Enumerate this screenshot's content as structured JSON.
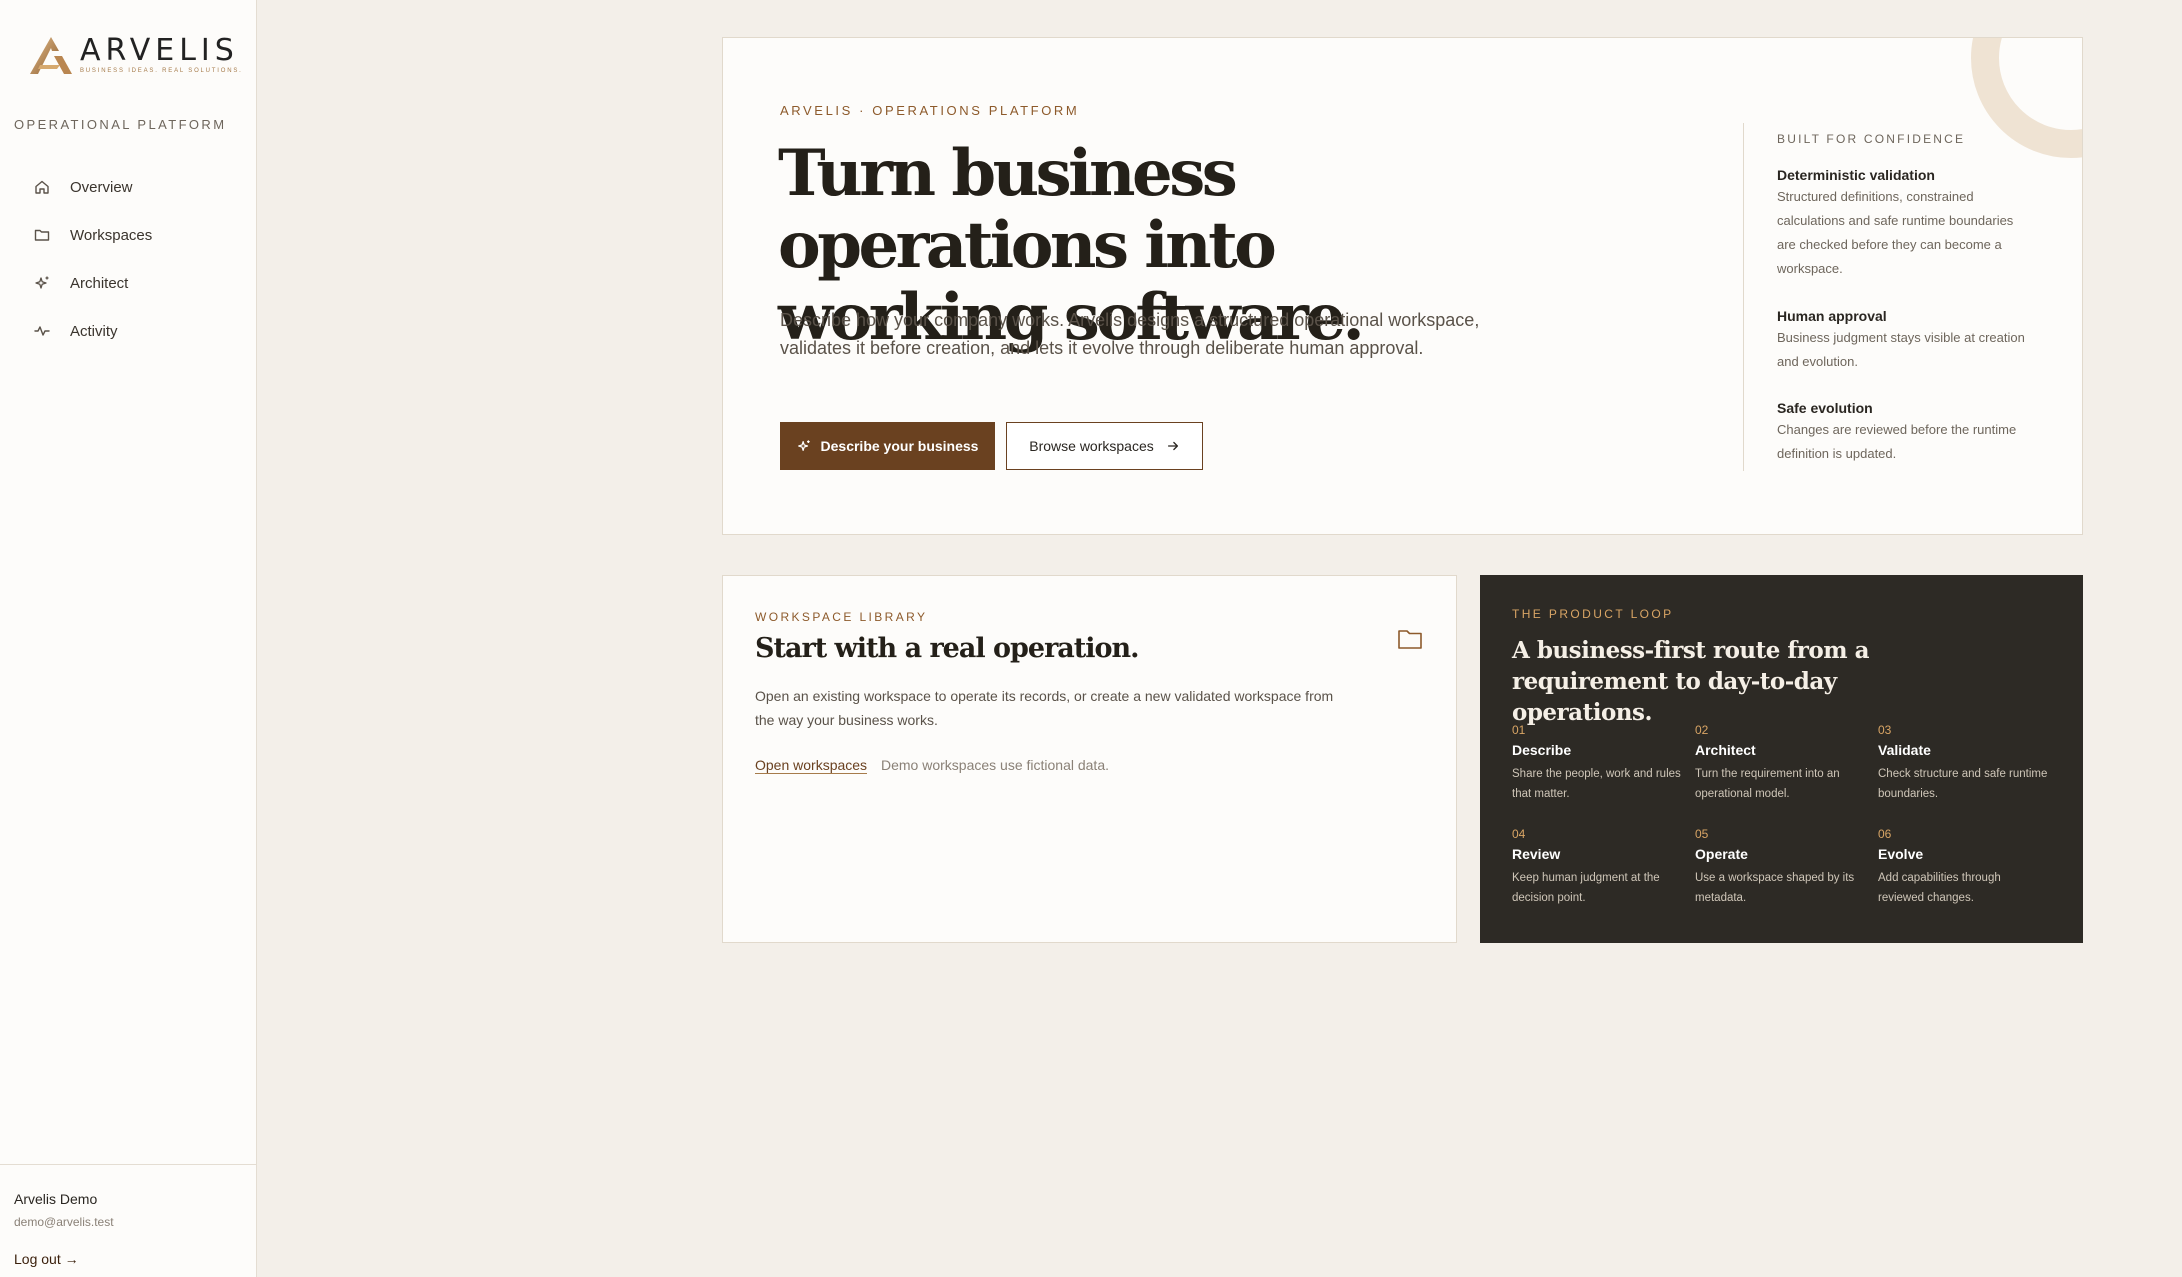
{
  "sidebar": {
    "logo": {
      "word": "ARVELIS",
      "tagline": "BUSINESS IDEAS. REAL SOLUTIONS."
    },
    "platform_label": "OPERATIONAL PLATFORM",
    "items": [
      {
        "label": "Overview",
        "icon": "home-icon"
      },
      {
        "label": "Workspaces",
        "icon": "folder-icon"
      },
      {
        "label": "Architect",
        "icon": "sparkle-icon"
      },
      {
        "label": "Activity",
        "icon": "activity-icon"
      }
    ],
    "user": {
      "name": "Arvelis Demo",
      "email": "demo@arvelis.test"
    },
    "logout_label": "Log out →"
  },
  "hero": {
    "eyebrow": "ARVELIS · OPERATIONS PLATFORM",
    "title": "Turn business operations into working software.",
    "description": "Describe how your company works. Arvelis designs a structured operational workspace, validates it before creation, and lets it evolve through deliberate human approval.",
    "primary_button": "Describe your business",
    "secondary_button": "Browse workspaces"
  },
  "confidence": {
    "eyebrow": "BUILT FOR CONFIDENCE",
    "items": [
      {
        "title": "Deterministic validation",
        "text": "Structured definitions, constrained calculations and safe runtime boundaries are checked before they can become a workspace."
      },
      {
        "title": "Human approval",
        "text": "Business judgment stays visible at creation and evolution."
      },
      {
        "title": "Safe evolution",
        "text": "Changes are reviewed before the runtime definition is updated."
      }
    ]
  },
  "library": {
    "eyebrow": "WORKSPACE LIBRARY",
    "title": "Start with a real operation.",
    "description": "Open an existing workspace to operate its records, or create a new validated workspace from the way your business works.",
    "link": "Open workspaces",
    "note": "Demo workspaces use fictional data."
  },
  "loop": {
    "eyebrow": "THE PRODUCT LOOP",
    "title": "A business-first route from a requirement to day-to-day operations.",
    "steps": [
      {
        "num": "01",
        "title": "Describe",
        "text": "Share the people, work and rules that matter."
      },
      {
        "num": "02",
        "title": "Architect",
        "text": "Turn the requirement into an operational model."
      },
      {
        "num": "03",
        "title": "Validate",
        "text": "Check structure and safe runtime boundaries."
      },
      {
        "num": "04",
        "title": "Review",
        "text": "Keep human judgment at the decision point."
      },
      {
        "num": "05",
        "title": "Operate",
        "text": "Use a workspace shaped by its metadata."
      },
      {
        "num": "06",
        "title": "Evolve",
        "text": "Add capabilities through reviewed changes."
      }
    ]
  },
  "colors": {
    "accent": "#6a4120",
    "eyebrow": "#8d5a2b",
    "dark_card": "#2d2a25",
    "step_accent": "#d9a565",
    "background": "#f3efe9"
  }
}
